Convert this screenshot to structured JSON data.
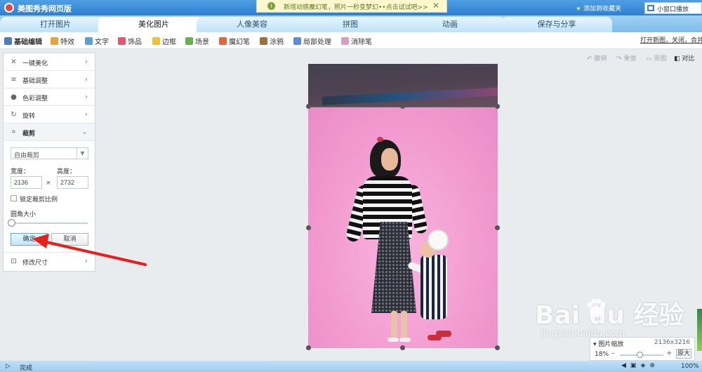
{
  "titlebar": {
    "app_title": "美图秀秀网页版",
    "notice_icon": "i",
    "notice": "新增动感魔幻笔，照片一秒变梦幻••点击试试吧>>",
    "notice_close": "✕",
    "favorite": "添加到收藏夹",
    "mini_window": "小窗口播放"
  },
  "tabs": [
    {
      "label": "打开图片"
    },
    {
      "label": "美化图片"
    },
    {
      "label": "人像美容"
    },
    {
      "label": "拼图"
    },
    {
      "label": "动画"
    },
    {
      "label": "保存与分享"
    }
  ],
  "toolbar": {
    "items": [
      {
        "label": "基础编辑",
        "icon": "basic-edit-icon"
      },
      {
        "label": "特效",
        "icon": "effects-icon"
      },
      {
        "label": "文字",
        "icon": "text-icon"
      },
      {
        "label": "饰品",
        "icon": "accessory-icon"
      },
      {
        "label": "边框",
        "icon": "frame-icon"
      },
      {
        "label": "场景",
        "icon": "scene-icon"
      },
      {
        "label": "魔幻笔",
        "icon": "magic-pen-icon"
      },
      {
        "label": "涂鸦",
        "icon": "doodle-icon"
      },
      {
        "label": "局部处理",
        "icon": "local-process-icon"
      },
      {
        "label": "消除笔",
        "icon": "eraser-icon"
      }
    ],
    "right_link": "打开新图，关闭，合并"
  },
  "left_panel": {
    "items": [
      {
        "label": "一键美化",
        "icon": "✕"
      },
      {
        "label": "基础调整",
        "icon": "≡"
      },
      {
        "label": "色彩调整",
        "icon": "●"
      },
      {
        "label": "旋转",
        "icon": "↻"
      },
      {
        "label": "裁剪",
        "icon": "⌗"
      }
    ],
    "crop": {
      "mode": "自由裁剪",
      "width_label": "宽度：",
      "height_label": "高度：",
      "width_value": "2136",
      "height_value": "2732",
      "times": "×",
      "lock_label": "锁定裁剪比例",
      "radius_label": "圆角大小",
      "confirm": "确定",
      "cancel": "取消"
    },
    "resize": {
      "label": "修改尺寸",
      "icon": "⊡"
    }
  },
  "canvas_toolbar": {
    "undo": "撤销",
    "redo": "重做",
    "original": "原图",
    "compare": "对比"
  },
  "zoom": {
    "title": "图片缩放",
    "size": "2136x3216",
    "percent": "18%",
    "level": 0.18,
    "original_btn": "原大"
  },
  "watermark": {
    "main": "Bai  du 经验",
    "sub": "jingyan.baidu.com"
  },
  "statusbar": {
    "status": "完成",
    "zoom": "100%"
  },
  "colors": {
    "accent": "#2f7fd0",
    "arrow": "#e8201c",
    "photo_bg": "#f29ad0"
  }
}
